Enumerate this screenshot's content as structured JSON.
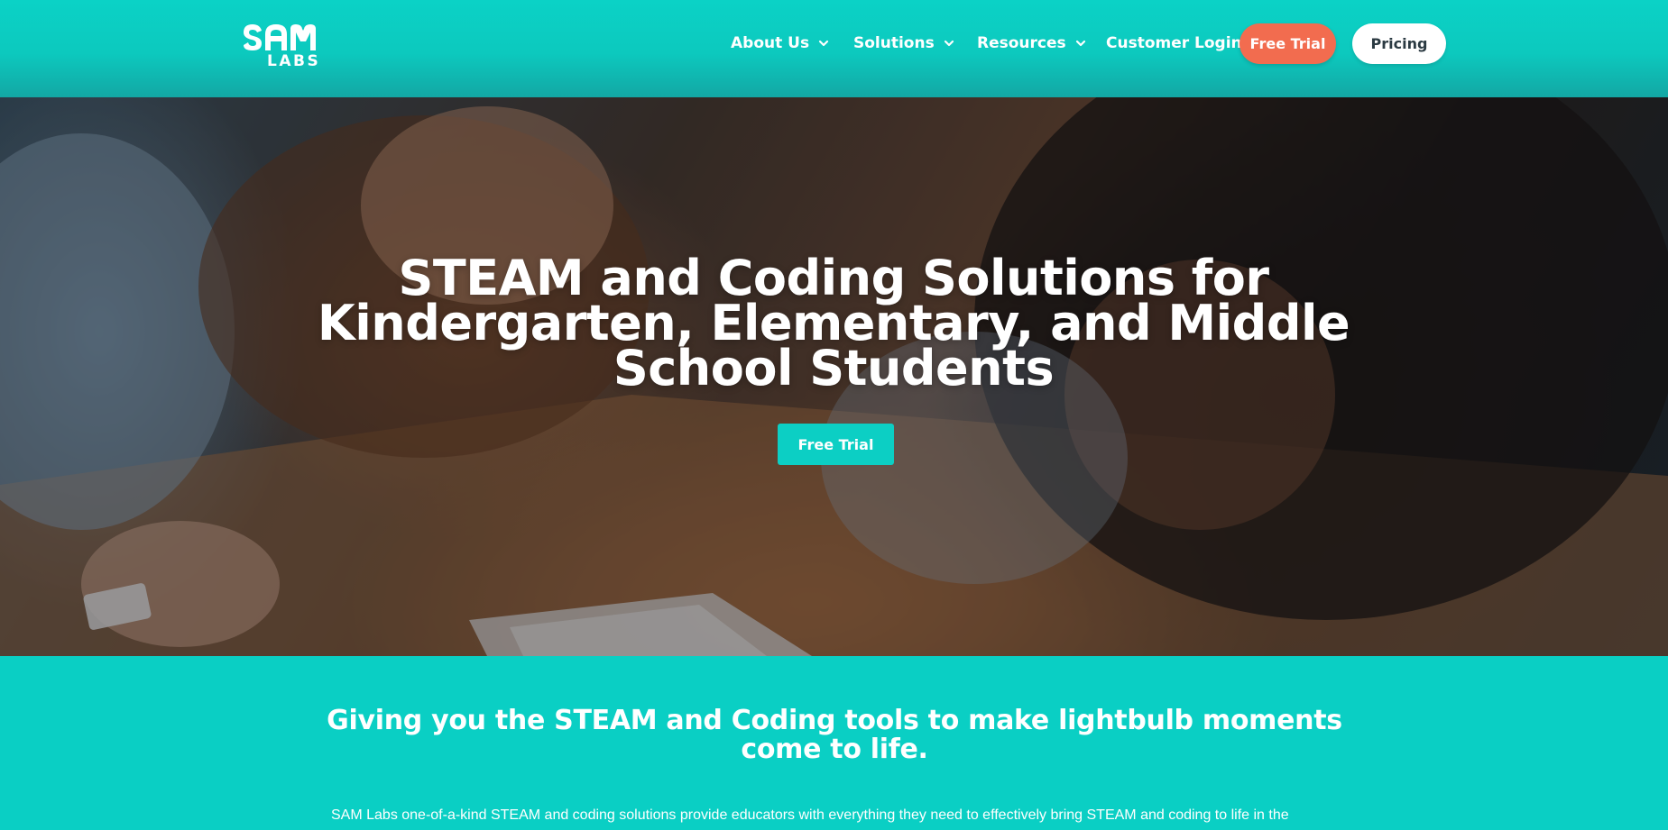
{
  "colors": {
    "brand_teal": "#0acfc4",
    "accent_orange": "#f26c4f",
    "white": "#ffffff",
    "pricing_text": "#2b3a42"
  },
  "header": {
    "logo": {
      "line1": "SAM",
      "line2": "LABS",
      "icon": "sam-labs-logo"
    },
    "nav": [
      {
        "label": "About Us",
        "has_dropdown": true
      },
      {
        "label": "Solutions",
        "has_dropdown": true
      },
      {
        "label": "Resources",
        "has_dropdown": true
      },
      {
        "label": "Customer Login",
        "has_dropdown": false
      }
    ],
    "free_trial_label": "Free Trial",
    "pricing_label": "Pricing"
  },
  "hero": {
    "title": "STEAM and Coding Solutions for Kindergarten, Elementary, and Middle School Students",
    "cta_label": "Free Trial"
  },
  "intro": {
    "heading": "Giving you the STEAM and Coding tools to make lightbulb moments come to life.",
    "body": "SAM Labs one-of-a-kind STEAM and coding solutions provide educators with everything they need to effectively bring STEAM and coding to life in the"
  }
}
